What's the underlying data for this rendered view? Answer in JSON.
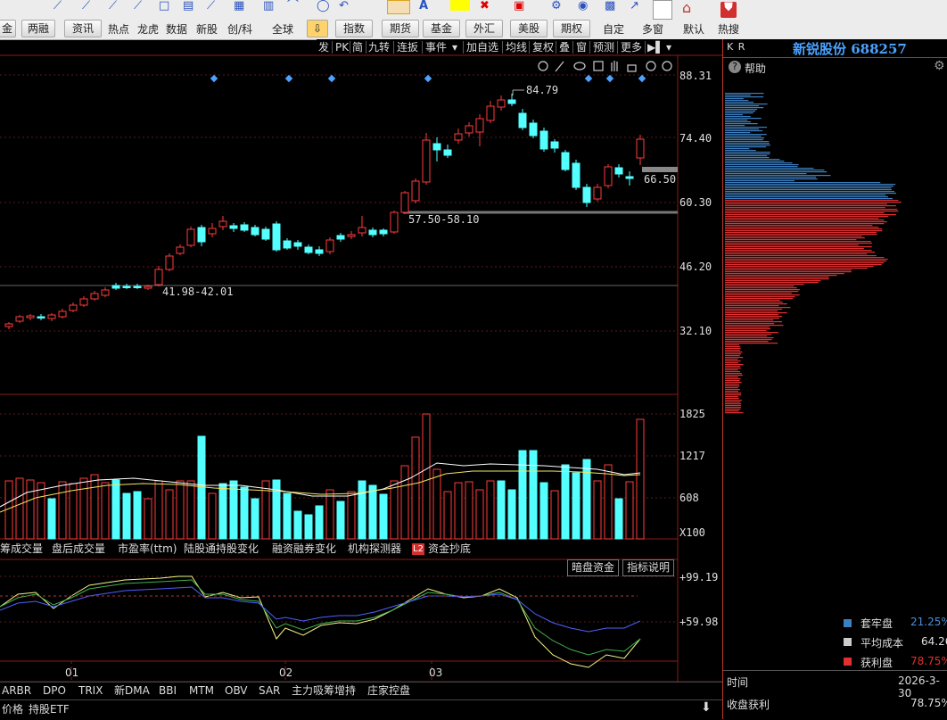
{
  "toolbar": {
    "buttons": [
      "金",
      "两融",
      "资讯",
      "指数",
      "期货",
      "基金",
      "外汇",
      "美股",
      "期权"
    ],
    "labels": [
      "热点",
      "龙虎",
      "数据",
      "新股",
      "创/科",
      "全球",
      "自定",
      "多窗",
      "默认",
      "热搜"
    ]
  },
  "menu_strip": [
    "发",
    "PK",
    "简",
    "九转",
    "连扳",
    "事件",
    "加自选",
    "均线",
    "复权",
    "叠",
    "窗",
    "预测",
    "更多"
  ],
  "stock": {
    "name_code": "新锐股份 688257",
    "kr": "K R"
  },
  "price_axis": {
    "labels": [
      "88.31",
      "74.40",
      "60.30",
      "46.20",
      "32.10"
    ]
  },
  "annotations": {
    "high": "84.79",
    "current": "66.50",
    "range1": "57.50-58.10",
    "range2": "41.98-42.01"
  },
  "volume_axis": {
    "labels": [
      "1825",
      "1217",
      "608",
      "X100"
    ]
  },
  "indicator_tabs": [
    "筹成交量",
    "盘后成交量",
    "市盈率(ttm)",
    "陆股通持股变化",
    "融资融券变化",
    "机构探测器",
    "资金抄底"
  ],
  "indicator_buttons": {
    "dark_funds": "暗盘资金",
    "explain": "指标说明"
  },
  "indicator_axis": {
    "labels": [
      "+99.19",
      "+59.98"
    ]
  },
  "x_labels": [
    "01",
    "02",
    "03"
  ],
  "bottom_tabs": [
    "ARBR",
    "DPO",
    "TRIX",
    "新DMA",
    "BBI",
    "MTM",
    "OBV",
    "SAR",
    "主力吸筹增持",
    "庄家控盘"
  ],
  "bottom_row2": [
    "价格",
    "持股ETF"
  ],
  "help": "帮助",
  "l2": "L2",
  "legend": [
    {
      "label": "套牢盘",
      "value": "21.25%",
      "color": "#3d7fc1"
    },
    {
      "label": "平均成本",
      "value": "64.26",
      "color": "#cccccc"
    },
    {
      "label": "获利盘",
      "value": "78.75%",
      "color": "#e23030"
    }
  ],
  "time_row": {
    "label": "时间",
    "value": "2026-3-30"
  },
  "profit_row": {
    "label": "收盘获利",
    "value": "78.75%"
  },
  "colors": {
    "up": "#ff3b3b",
    "down": "#54ffff",
    "bg": "#000000",
    "grid": "#8b1a1a"
  }
}
